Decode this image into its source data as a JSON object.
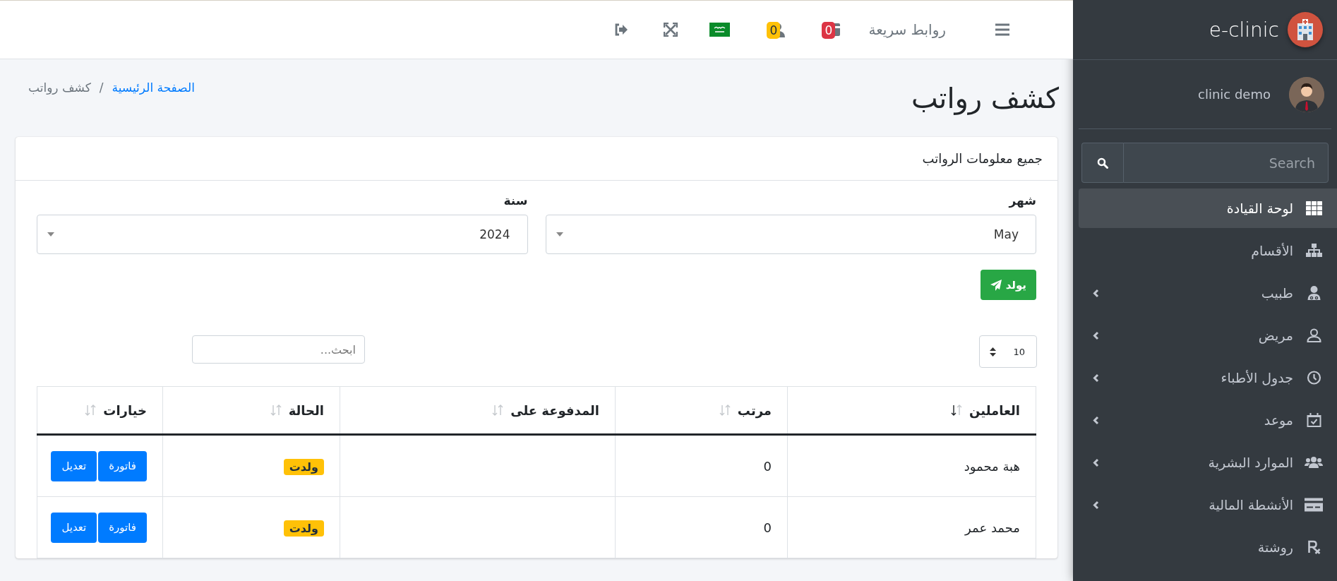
{
  "sidebar": {
    "brand": "e-clinic",
    "user": "clinic demo",
    "search": {
      "placeholder": "Search"
    },
    "items": [
      {
        "label": "لوحة القيادة",
        "selected": true,
        "has_submenu": false
      },
      {
        "label": "الأقسام",
        "selected": false,
        "has_submenu": false
      },
      {
        "label": "طبيب",
        "selected": false,
        "has_submenu": true
      },
      {
        "label": "مريض",
        "selected": false,
        "has_submenu": true
      },
      {
        "label": "جدول الأطباء",
        "selected": false,
        "has_submenu": true
      },
      {
        "label": "موعد",
        "selected": false,
        "has_submenu": true
      },
      {
        "label": "الموارد البشرية",
        "selected": false,
        "has_submenu": true
      },
      {
        "label": "الأنشطة المالية",
        "selected": false,
        "has_submenu": true
      },
      {
        "label": "روشتة",
        "selected": false,
        "has_submenu": false
      }
    ]
  },
  "navbar": {
    "quick_links": "روابط سريعة",
    "counters": [
      {
        "count": "0",
        "color": "#dc3545"
      },
      {
        "count": "0",
        "color": "#ffc107"
      }
    ]
  },
  "page": {
    "title": "كشف رواتب",
    "breadcrumb": [
      {
        "label": "الصفحة الرئيسية",
        "link": true
      },
      {
        "label": "كشف رواتب",
        "link": false
      }
    ],
    "breadcrumb_separator": "/"
  },
  "card": {
    "header": "جميع معلومات الرواتب",
    "filters": [
      {
        "label": "شهر",
        "value": "May"
      },
      {
        "label": "سنة",
        "value": "2024"
      }
    ],
    "generate_button": "يولد",
    "page_length": "10",
    "table_search": {
      "placeholder": "ابحث..."
    },
    "table": {
      "columns": [
        {
          "label": "العاملين",
          "sorted": true
        },
        {
          "label": "مرتب",
          "sorted": false
        },
        {
          "label": "المدفوعة على",
          "sorted": false
        },
        {
          "label": "الحالة",
          "sorted": false
        },
        {
          "label": "خيارات",
          "sorted": false
        }
      ],
      "rows": [
        {
          "name": "هبة محمود",
          "salary": "0",
          "status": "ولدت",
          "buttons": [
            "فاتورة",
            "تعديل"
          ]
        },
        {
          "name": "محمد عمر",
          "salary": "0",
          "status": "ولدت",
          "buttons": [
            "فاتورة",
            "تعديل"
          ]
        }
      ]
    }
  }
}
